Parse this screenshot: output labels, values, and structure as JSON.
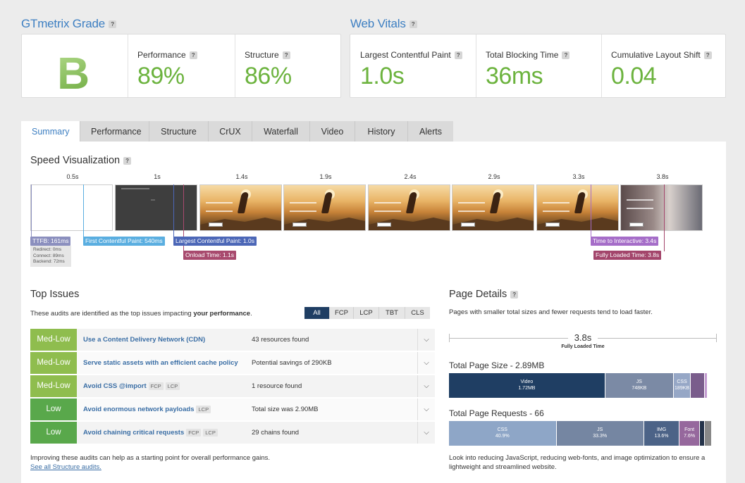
{
  "grade": {
    "title": "GTmetrix Grade",
    "letter": "B",
    "performance_label": "Performance",
    "performance": "89%",
    "structure_label": "Structure",
    "structure": "86%"
  },
  "vitals": {
    "title": "Web Vitals",
    "lcp_label": "Largest Contentful Paint",
    "lcp": "1.0s",
    "tbt_label": "Total Blocking Time",
    "tbt": "36ms",
    "cls_label": "Cumulative Layout Shift",
    "cls": "0.04"
  },
  "help_glyph": "?",
  "tabs": [
    "Summary",
    "Performance",
    "Structure",
    "CrUX",
    "Waterfall",
    "Video",
    "History",
    "Alerts"
  ],
  "speed": {
    "title": "Speed Visualization",
    "times": [
      "0.5s",
      "1s",
      "1.4s",
      "1.9s",
      "2.4s",
      "2.9s",
      "3.3s",
      "3.8s"
    ],
    "markers": {
      "ttfb": "TTFB: 161ms",
      "ttfb_details": [
        "Redirect: 0ms",
        "Connect: 89ms",
        "Backend: 72ms"
      ],
      "fcp": "First Contentful Paint: 540ms",
      "lcp": "Largest Contentful Paint: 1.0s",
      "onload": "Onload Time: 1.1s",
      "tti": "Time to Interactive: 3.4s",
      "fully": "Fully Loaded Time: 3.8s"
    },
    "colors": {
      "ttfb": "#8b8fbe",
      "fcp": "#5aaee0",
      "lcp": "#4c67b7",
      "onload": "#a84a6e",
      "tti": "#a56dc8",
      "fully": "#a3456b"
    }
  },
  "top_issues": {
    "title": "Top Issues",
    "desc_prefix": "These audits are identified as the top issues impacting ",
    "desc_bold": "your performance",
    "desc_suffix": ".",
    "filters": [
      "All",
      "FCP",
      "LCP",
      "TBT",
      "CLS"
    ],
    "rows": [
      {
        "badge": "Med-Low",
        "color": "#8fbd4e",
        "name": "Use a Content Delivery Network (CDN)",
        "tags": [],
        "value": "43 resources found"
      },
      {
        "badge": "Med-Low",
        "color": "#8fbd4e",
        "name": "Serve static assets with an efficient cache policy",
        "tags": [],
        "value": "Potential savings of 290KB"
      },
      {
        "badge": "Med-Low",
        "color": "#8fbd4e",
        "name": "Avoid CSS @import",
        "tags": [
          "FCP",
          "LCP"
        ],
        "value": "1 resource found"
      },
      {
        "badge": "Low",
        "color": "#59a84b",
        "name": "Avoid enormous network payloads",
        "tags": [
          "LCP"
        ],
        "value": "Total size was 2.90MB"
      },
      {
        "badge": "Low",
        "color": "#59a84b",
        "name": "Avoid chaining critical requests",
        "tags": [
          "FCP",
          "LCP"
        ],
        "value": "29 chains found"
      }
    ],
    "footer": "Improving these audits can help as a starting point for overall performance gains.",
    "link": "See all Structure audits."
  },
  "page_details": {
    "title": "Page Details",
    "desc": "Pages with smaller total sizes and fewer requests tend to load faster.",
    "fully_time": "3.8s",
    "fully_label": "Fully Loaded Time",
    "size_title": "Total Page Size - 2.89MB",
    "size_segments": [
      {
        "label": "Video",
        "value": "1.72MB",
        "share": 0.59,
        "color": "#1f3e63"
      },
      {
        "label": "JS",
        "value": "748KB",
        "share": 0.258,
        "color": "#7b8aa5"
      },
      {
        "label": "CSS",
        "value": "189KB",
        "share": 0.065,
        "color": "#96a7c6"
      },
      {
        "label": "",
        "value": "",
        "share": 0.052,
        "color": "#7a5d8c"
      },
      {
        "label": "",
        "value": "",
        "share": 0.012,
        "color": "#c39bd0"
      }
    ],
    "requests_title": "Total Page Requests - 66",
    "request_segments": [
      {
        "label": "CSS",
        "value": "40.9%",
        "share": 0.409,
        "color": "#8ea6c7"
      },
      {
        "label": "JS",
        "value": "33.3%",
        "share": 0.333,
        "color": "#7586a2"
      },
      {
        "label": "IMG",
        "value": "13.6%",
        "share": 0.136,
        "color": "#4c6387"
      },
      {
        "label": "Font",
        "value": "7.6%",
        "share": 0.076,
        "color": "#96689d"
      },
      {
        "label": "",
        "value": "",
        "share": 0.02,
        "color": "#24334a"
      },
      {
        "label": "",
        "value": "",
        "share": 0.026,
        "color": "#888"
      }
    ],
    "footer": "Look into reducing JavaScript, reducing web-fonts, and image optimization to ensure a lightweight and streamlined website."
  }
}
